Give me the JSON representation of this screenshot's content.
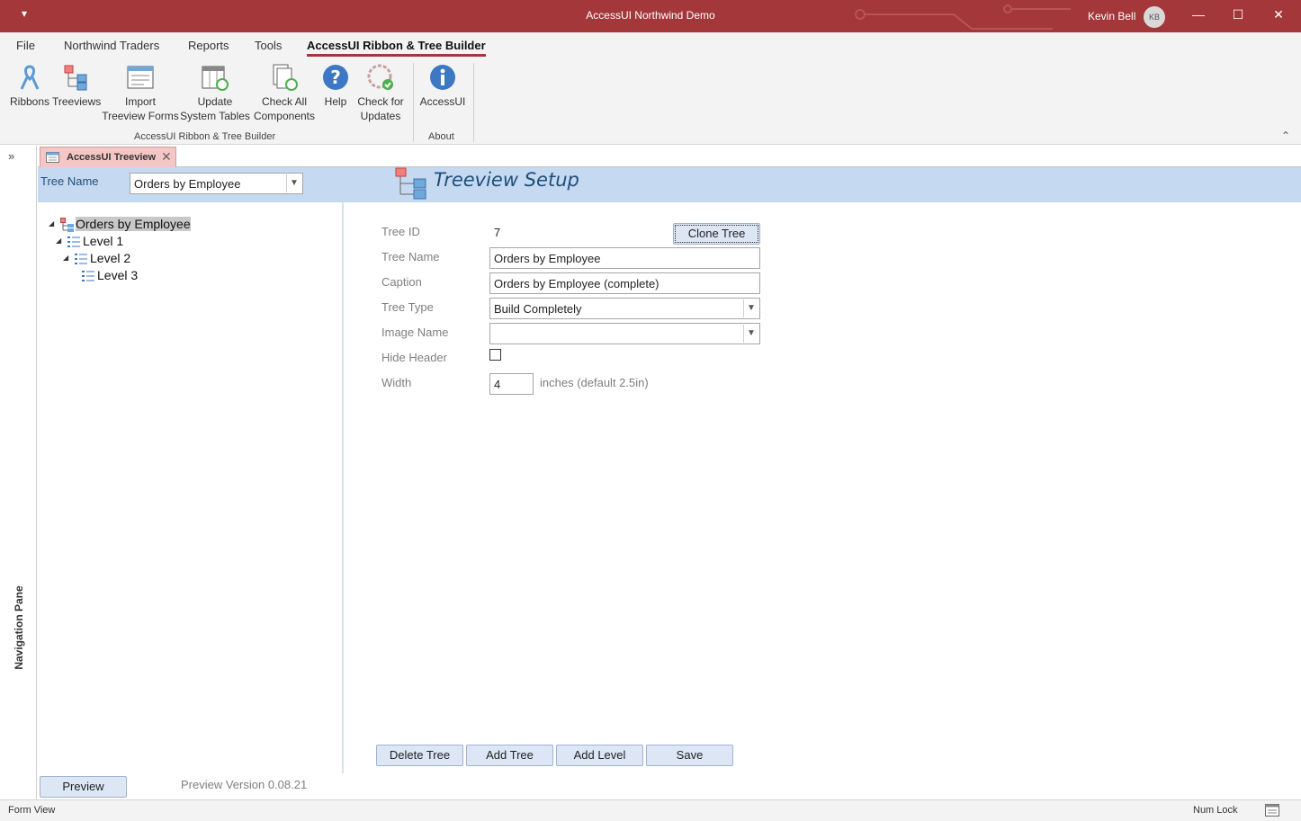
{
  "window": {
    "title": "AccessUI Northwind Demo",
    "qat_glyph": "▾",
    "user_name": "Kevin Bell",
    "user_initials": "KB",
    "minimize": "—",
    "maximize": "☐",
    "close": "✕"
  },
  "ribbon_tabs": [
    "File",
    "Northwind Traders",
    "Reports",
    "Tools",
    "AccessUI Ribbon & Tree Builder"
  ],
  "ribbon": {
    "buttons": {
      "ribbons": "Ribbons",
      "treeviews": "Treeviews",
      "import_1": "Import",
      "import_2": "Treeview Forms",
      "update_1": "Update",
      "update_2": "System Tables",
      "check_all_1": "Check All",
      "check_all_2": "Components",
      "help": "Help",
      "check_updates_1": "Check for",
      "check_updates_2": "Updates",
      "accessui": "AccessUI"
    },
    "groups": {
      "builder": "AccessUI Ribbon & Tree Builder",
      "about": "About"
    },
    "collapse_glyph": "⌃"
  },
  "nav_pane": {
    "chevron": "»",
    "label": "Navigation Pane"
  },
  "document_tab": {
    "label": "AccessUI Treeview",
    "close": "✕"
  },
  "header": {
    "tree_name_label": "Tree Name",
    "tree_name_value": "Orders by Employee",
    "title": "Treeview Setup"
  },
  "tree": {
    "nodes": [
      {
        "label": "Orders by Employee",
        "expander": "◢"
      },
      {
        "label": "Level 1",
        "expander": "◢"
      },
      {
        "label": "Level 2",
        "expander": "◢"
      },
      {
        "label": "Level 3",
        "expander": ""
      }
    ]
  },
  "fields": {
    "tree_id_label": "Tree ID",
    "tree_id_value": "7",
    "tree_name_label": "Tree Name",
    "tree_name_value": "Orders by Employee",
    "caption_label": "Caption",
    "caption_value": "Orders by Employee (complete)",
    "tree_type_label": "Tree Type",
    "tree_type_value": "Build Completely",
    "image_name_label": "Image Name",
    "image_name_value": "",
    "hide_header_label": "Hide Header",
    "hide_header_checked": false,
    "width_label": "Width",
    "width_value": "4",
    "width_note": "inches (default 2.5in)"
  },
  "buttons": {
    "clone_tree": "Clone Tree",
    "delete_tree": "Delete Tree",
    "add_tree": "Add Tree",
    "add_level": "Add Level",
    "save": "Save",
    "preview": "Preview"
  },
  "version_text": "Preview Version 0.08.21",
  "status": {
    "left": "Form View",
    "num_lock": "Num Lock"
  },
  "colors": {
    "title_bar": "#a4373a",
    "header_band": "#c5d9f1",
    "title_text": "#1f4e79",
    "document_tab": "#f4c6c6"
  }
}
